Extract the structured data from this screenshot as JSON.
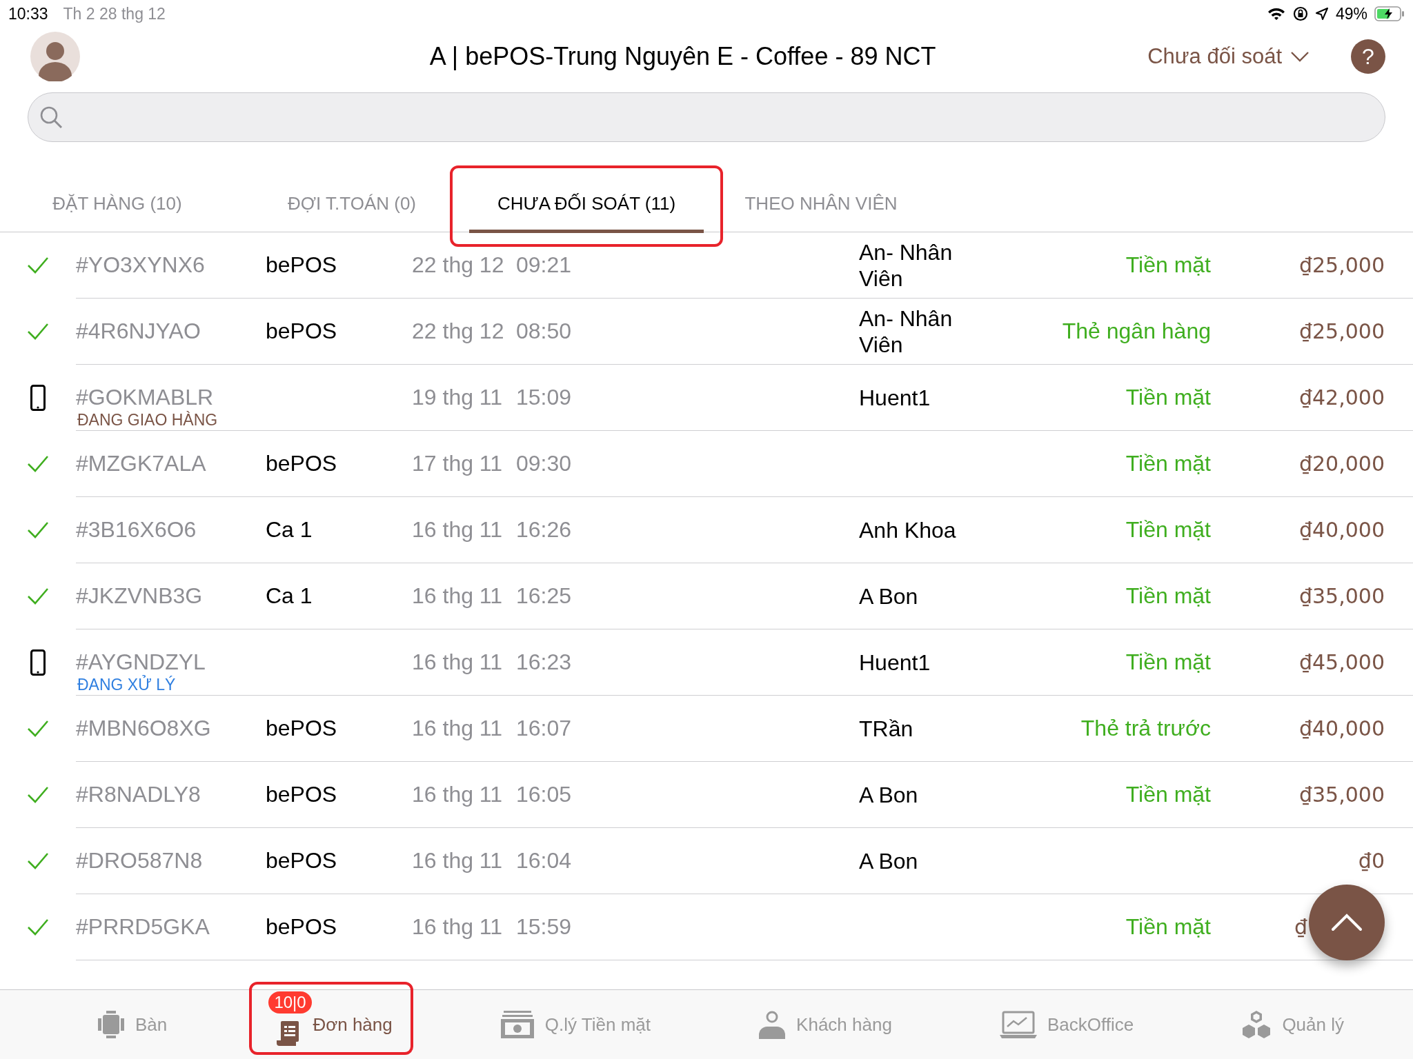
{
  "status_bar": {
    "time": "10:33",
    "date": "Th 2 28 thg 12",
    "battery_text": "49%"
  },
  "header": {
    "title": "A | bePOS-Trung Nguyên E - Coffee - 89 NCT",
    "filter": "Chưa đối soát",
    "help": "?"
  },
  "tabs": [
    {
      "label": "ĐẶT HÀNG (10)",
      "selected": false,
      "highlighted": false
    },
    {
      "label": "ĐỢI T.TOÁN (0)",
      "selected": false,
      "highlighted": false
    },
    {
      "label": "CHƯA ĐỐI SOÁT (11)",
      "selected": true,
      "highlighted": true
    },
    {
      "label": "THEO NHÂN VIÊN",
      "selected": false,
      "highlighted": false
    }
  ],
  "orders": [
    {
      "kind": "check",
      "code": "#YO3XYNX6",
      "source": "bePOS",
      "date": "22 thg 12",
      "time": "09:21",
      "staff": "An- Nhân Viên",
      "payment": "Tiền mặt",
      "amount": "₫25,000"
    },
    {
      "kind": "check",
      "code": "#4R6NJYAO",
      "source": "bePOS",
      "date": "22 thg 12",
      "time": "08:50",
      "staff": "An- Nhân Viên",
      "payment": "Thẻ ngân hàng",
      "amount": "₫25,000"
    },
    {
      "kind": "phone",
      "code": "#GOKMABLR",
      "status": "ĐANG GIAO HÀNG",
      "color": "#7a5446",
      "date": "19 thg 11",
      "time": "15:09",
      "staff": "Huent1",
      "payment": "Tiền mặt",
      "amount": "₫42,000"
    },
    {
      "kind": "check",
      "code": "#MZGK7ALA",
      "source": "bePOS",
      "date": "17 thg 11",
      "time": "09:30",
      "payment": "Tiền mặt",
      "amount": "₫20,000"
    },
    {
      "kind": "check",
      "code": "#3B16X6O6",
      "source": "Ca 1",
      "date": "16 thg 11",
      "time": "16:26",
      "staff": "Anh Khoa",
      "payment": "Tiền mặt",
      "amount": "₫40,000"
    },
    {
      "kind": "check",
      "code": "#JKZVNB3G",
      "source": "Ca 1",
      "date": "16 thg 11",
      "time": "16:25",
      "staff": "A Bon",
      "payment": "Tiền mặt",
      "amount": "₫35,000"
    },
    {
      "kind": "phone",
      "code": "#AYGNDZYL",
      "status": "ĐANG XỬ LÝ",
      "color": "#2f7fe0",
      "date": "16 thg 11",
      "time": "16:23",
      "staff": "Huent1",
      "payment": "Tiền mặt",
      "amount": "₫45,000"
    },
    {
      "kind": "check",
      "code": "#MBN6O8XG",
      "source": "bePOS",
      "date": "16 thg 11",
      "time": "16:07",
      "staff": "TRần",
      "payment": "Thẻ trả trước",
      "amount": "₫40,000"
    },
    {
      "kind": "check",
      "code": "#R8NADLY8",
      "source": "bePOS",
      "date": "16 thg 11",
      "time": "16:05",
      "staff": "A Bon",
      "payment": "Tiền mặt",
      "amount": "₫35,000"
    },
    {
      "kind": "check",
      "code": "#DRO587N8",
      "source": "bePOS",
      "date": "16 thg 11",
      "time": "16:04",
      "staff": "A Bon",
      "amount": "₫0"
    },
    {
      "kind": "check",
      "code": "#PRRD5GKA",
      "source": "bePOS",
      "date": "16 thg 11",
      "time": "15:59",
      "payment": "Tiền mặt",
      "amount": "₫"
    }
  ],
  "nav": [
    {
      "kind": "table",
      "label": "Bàn",
      "selected": false,
      "highlighted": false
    },
    {
      "kind": "orders",
      "label": "Đơn hàng",
      "badge": "10|0",
      "selected": true,
      "highlighted": true
    },
    {
      "kind": "cash",
      "label": "Q.lý Tiền mặt",
      "selected": false,
      "highlighted": false
    },
    {
      "kind": "customer",
      "label": "Khách hàng",
      "selected": false,
      "highlighted": false
    },
    {
      "kind": "backoffice",
      "label": "BackOffice",
      "selected": false,
      "highlighted": false
    },
    {
      "kind": "manage",
      "label": "Quản lý",
      "selected": false,
      "highlighted": false
    }
  ]
}
